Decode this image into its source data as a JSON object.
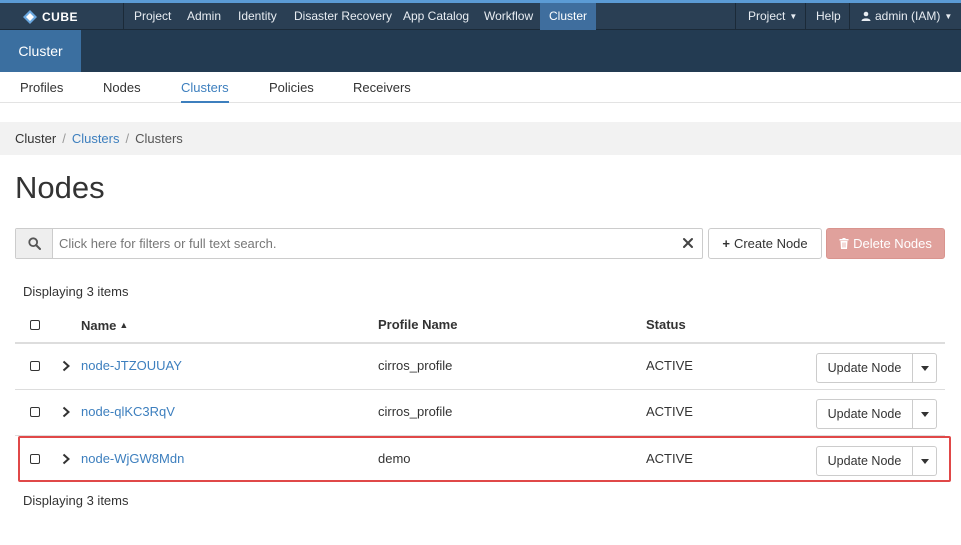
{
  "brand": {
    "name": "CUBE"
  },
  "navbar": {
    "items": [
      "Project",
      "Admin",
      "Identity",
      "Disaster Recovery",
      "App Catalog",
      "Workflow",
      "Cluster"
    ],
    "active": "Cluster",
    "right": {
      "project_menu": "Project",
      "help": "Help",
      "user_menu": "admin (IAM)"
    }
  },
  "panel": {
    "active_dashboard": "Cluster"
  },
  "tabs": [
    {
      "label": "Profiles",
      "active": false
    },
    {
      "label": "Nodes",
      "active": false
    },
    {
      "label": "Clusters",
      "active": true
    },
    {
      "label": "Policies",
      "active": false
    },
    {
      "label": "Receivers",
      "active": false
    }
  ],
  "breadcrumb": {
    "root": "Cluster",
    "link": "Clusters",
    "current": "Clusters"
  },
  "page": {
    "title": "Nodes"
  },
  "search": {
    "placeholder": "Click here for filters or full text search.",
    "value": ""
  },
  "buttons": {
    "create": "Create Node",
    "delete": "Delete Nodes"
  },
  "table": {
    "count_text": "Displaying 3 items",
    "columns": {
      "name": "Name",
      "profile": "Profile Name",
      "status": "Status"
    },
    "sort": {
      "column": "Name",
      "direction": "ascending"
    },
    "rows": [
      {
        "name": "node-JTZOUUAY",
        "profile": "cirros_profile",
        "status": "ACTIVE",
        "action": "Update Node",
        "highlighted": false
      },
      {
        "name": "node-qlKC3RqV",
        "profile": "cirros_profile",
        "status": "ACTIVE",
        "action": "Update Node",
        "highlighted": false
      },
      {
        "name": "node-WjGW8Mdn",
        "profile": "demo",
        "status": "ACTIVE",
        "action": "Update Node",
        "highlighted": true
      }
    ]
  },
  "colors": {
    "navbar": "#2a3f54",
    "subheader": "#233b52",
    "active_tab": "#3b6fa0",
    "link": "#3d7fbe",
    "delete_button": "#e0a19c",
    "highlight_border": "#e04848"
  }
}
